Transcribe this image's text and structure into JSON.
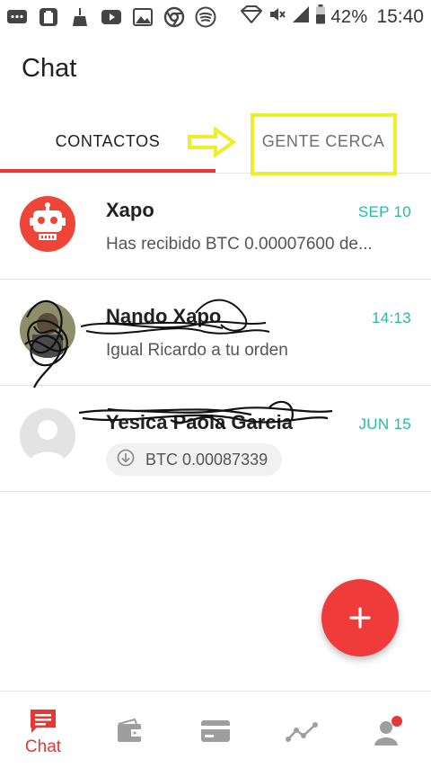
{
  "status_bar": {
    "icons": [
      "chat-bubble-icon",
      "clipboard-icon",
      "broom-icon",
      "youtube-icon",
      "image-icon",
      "chrome-icon",
      "spotify-icon"
    ],
    "right_icons": [
      "vpn-diamond-icon",
      "mute-icon",
      "signal-icon",
      "battery-icon"
    ],
    "battery": "42%",
    "time": "15:40"
  },
  "header": {
    "title": "Chat"
  },
  "tabs": [
    {
      "label": "CONTACTOS",
      "active": true
    },
    {
      "label": "GENTE CERCA",
      "active": false
    }
  ],
  "chats": [
    {
      "name": "Xapo",
      "time": "SEP 10",
      "preview": "Has recibido BTC 0.00007600 de...",
      "avatar": "robot-icon"
    },
    {
      "name": "Nando Xapo",
      "time": "14:13",
      "preview": "Igual Ricardo a tu orden",
      "avatar": "photo"
    },
    {
      "name": "Yesica Paola Garcia",
      "time": "JUN 15",
      "preview": "BTC 0.00087339",
      "avatar": "person-placeholder-icon"
    }
  ],
  "fab": {
    "icon": "plus-icon"
  },
  "bottom_nav": [
    {
      "icon": "chat-icon",
      "label": "Chat",
      "active": true
    },
    {
      "icon": "wallet-icon",
      "label": "",
      "active": false
    },
    {
      "icon": "card-icon",
      "label": "",
      "active": false
    },
    {
      "icon": "chart-icon",
      "label": "",
      "active": false
    },
    {
      "icon": "profile-icon",
      "label": "",
      "active": false
    }
  ],
  "colors": {
    "accent": "#e53935",
    "time_teal": "#27b8a6",
    "annotation_yellow": "#f0ee2a"
  }
}
